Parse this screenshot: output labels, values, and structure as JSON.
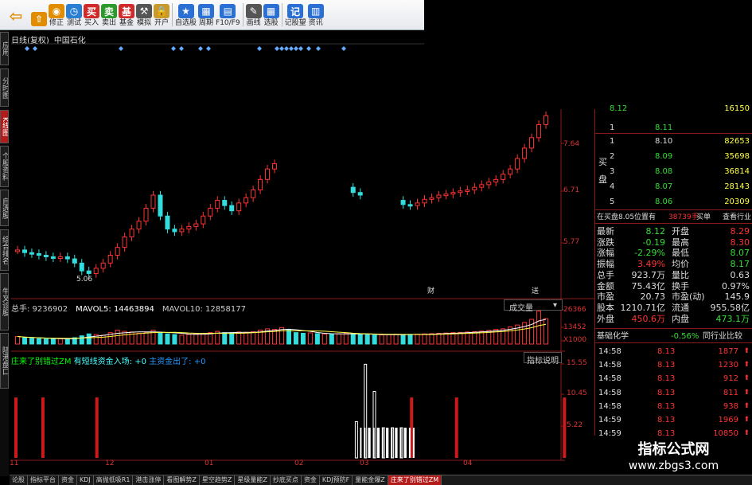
{
  "toolbar": [
    {
      "name": "back",
      "label": "",
      "icon": "back-arrow-icon",
      "color": "#e28c00",
      "big": true
    },
    {
      "name": "up",
      "label": "",
      "icon": "arrow-up-icon",
      "color": "#e28c00"
    },
    {
      "name": "modify",
      "label": "修正",
      "icon": "lifebuoy-icon",
      "color": "#e28c00"
    },
    {
      "name": "test",
      "label": "测试",
      "icon": "clock-icon",
      "color": "#2a7fd4"
    },
    {
      "name": "buy",
      "label": "买入",
      "icon": "buy-icon",
      "color": "#d02a2a",
      "text": "买"
    },
    {
      "name": "sell",
      "label": "卖出",
      "icon": "sell-icon",
      "color": "#2a9a2a",
      "text": "卖"
    },
    {
      "name": "fund",
      "label": "基金",
      "icon": "fund-icon",
      "color": "#d02a2a",
      "text": "基"
    },
    {
      "name": "simulate",
      "label": "模拟",
      "icon": "hammer-icon",
      "color": "#555"
    },
    {
      "name": "open",
      "label": "开户",
      "icon": "lock-icon",
      "color": "#c99a2a"
    },
    {
      "name": "watchlist",
      "label": "自选股",
      "icon": "star-icon",
      "color": "#2a6fd4"
    },
    {
      "name": "cycle",
      "label": "周期",
      "icon": "calendar-icon",
      "color": "#2a6fd4"
    },
    {
      "name": "f10",
      "label": "F10/F9",
      "icon": "document-icon",
      "color": "#2a6fd4"
    },
    {
      "name": "draw",
      "label": "画线",
      "icon": "pencil-icon",
      "color": "#555"
    },
    {
      "name": "select",
      "label": "选股",
      "icon": "grid-icon",
      "color": "#2a6fd4"
    },
    {
      "name": "note",
      "label": "记股望",
      "icon": "notebook-icon",
      "color": "#2a6fd4",
      "text": "记"
    },
    {
      "name": "news",
      "label": "资讯",
      "icon": "news-icon",
      "color": "#2a6fd4"
    }
  ],
  "side_tabs": [
    {
      "label": "应用",
      "active": false
    },
    {
      "label": "分时图",
      "active": false
    },
    {
      "label": "K线图",
      "active": true
    },
    {
      "label": "个股资料",
      "active": false
    },
    {
      "label": "自选股",
      "active": false
    },
    {
      "label": "综合排名",
      "active": false
    },
    {
      "label": "牛叉诊股",
      "active": false
    },
    {
      "label": "陆港盘口",
      "active": false
    }
  ],
  "kline": {
    "period": "日线(复权)",
    "stock": "中国石化",
    "price_labels": [
      "7.64",
      "6.71",
      "5.77"
    ],
    "low_label": "5.06",
    "marks": [
      "财",
      "送"
    ]
  },
  "volume_panel": {
    "total": "总手: 9236902",
    "ma5": "MAVOL5: 14463894",
    "ma10": "MAVOL10: 12858177",
    "selector": "成交量",
    "axis": [
      "26366",
      "13452",
      "X1000"
    ]
  },
  "indicator_panel": {
    "name": "庄来了别错过ZM",
    "text1": "有短线资金入场: +0",
    "text2": "主资金出了: +0",
    "explain": "指标说明",
    "axis": [
      "15.55",
      "10.45",
      "5.22"
    ]
  },
  "dates": [
    "11",
    "12",
    "01",
    "02",
    "03",
    "04"
  ],
  "bottom_tabs": [
    "论股",
    "指标平台",
    "资金",
    "KDJ",
    "高抛低吸R1",
    "港击涨停",
    "看图解势Z",
    "星空趋势Z",
    "星级量能Z",
    "抄底买点",
    "资金",
    "KDJ预防F",
    "量能金爆Z",
    "庄来了别错过ZM"
  ],
  "orderbook": {
    "top_partial": {
      "sell1_price": "8.12",
      "sell1_vol": "16150"
    },
    "sell1": {
      "idx": "1",
      "price": "8.11",
      "vol": ""
    },
    "buy_label": [
      "买",
      "盘"
    ],
    "buys": [
      {
        "idx": "1",
        "price": "8.10",
        "vol": "82653"
      },
      {
        "idx": "2",
        "price": "8.09",
        "vol": "35698"
      },
      {
        "idx": "3",
        "price": "8.08",
        "vol": "36814"
      },
      {
        "idx": "4",
        "price": "8.07",
        "vol": "28143"
      },
      {
        "idx": "5",
        "price": "8.06",
        "vol": "20309"
      }
    ],
    "bidline": {
      "text": "在买盘8.05位置有",
      "vol": "38739手",
      "buy_link": "买单",
      "industry_link": "查看行业"
    },
    "stats": [
      {
        "k1": "最新",
        "v1": "8.12",
        "c1": "green",
        "k2": "开盘",
        "v2": "8.29",
        "c2": "red"
      },
      {
        "k1": "涨跌",
        "v1": "-0.19",
        "c1": "green",
        "k2": "最高",
        "v2": "8.30",
        "c2": "red"
      },
      {
        "k1": "涨幅",
        "v1": "-2.29%",
        "c1": "green",
        "k2": "最低",
        "v2": "8.07",
        "c2": "green"
      },
      {
        "k1": "振幅",
        "v1": "3.49%",
        "c1": "red",
        "k2": "均价",
        "v2": "8.17",
        "c2": "green"
      },
      {
        "k1": "总手",
        "v1": "923.7万",
        "c1": "wht",
        "k2": "量比",
        "v2": "0.63",
        "c2": "wht"
      },
      {
        "k1": "金额",
        "v1": "75.43亿",
        "c1": "wht",
        "k2": "换手",
        "v2": "0.97%",
        "c2": "wht"
      },
      {
        "k1": "市盈",
        "v1": "20.73",
        "c1": "wht",
        "k2": "市盈(动)",
        "v2": "145.9",
        "c2": "wht"
      },
      {
        "k1": "股本",
        "v1": "1210.71亿",
        "c1": "wht",
        "k2": "流通",
        "v2": "955.58亿",
        "c2": "wht"
      },
      {
        "k1": "外盘",
        "v1": "450.6万",
        "c1": "red",
        "k2": "内盘",
        "v2": "473.1万",
        "c2": "green"
      }
    ],
    "sector": {
      "name": "基础化学",
      "pct": "-0.56%",
      "link": "同行业比较"
    },
    "ticks": [
      {
        "t": "14:58",
        "p": "8.13",
        "v": "1877"
      },
      {
        "t": "14:58",
        "p": "8.13",
        "v": "1230"
      },
      {
        "t": "14:58",
        "p": "8.13",
        "v": "912"
      },
      {
        "t": "14:58",
        "p": "8.13",
        "v": "811"
      },
      {
        "t": "14:58",
        "p": "8.13",
        "v": "938"
      },
      {
        "t": "14:59",
        "p": "8.13",
        "v": "1969"
      },
      {
        "t": "14:59",
        "p": "8.13",
        "v": "10850"
      }
    ]
  },
  "watermark": {
    "title": "指标公式网",
    "url": "www.zbgs3.com"
  },
  "colors": {
    "up": "#ff3333",
    "down": "#33dddd",
    "ma5": "#ffffff",
    "ma10": "#ffff44",
    "indicator_red": "#cc1a1a",
    "indicator_white": "#ffffff",
    "grid": "#8a1a1a"
  },
  "chart_data": [
    {
      "type": "candlestick",
      "title": "日线(复权) 中国石化",
      "note": "approximate closes read from chart",
      "close": [
        5.55,
        5.5,
        5.48,
        5.45,
        5.42,
        5.4,
        5.42,
        5.38,
        5.3,
        5.15,
        5.1,
        5.2,
        5.3,
        5.45,
        5.6,
        5.8,
        5.95,
        6.1,
        6.35,
        6.6,
        6.2,
        5.95,
        5.9,
        5.95,
        6.0,
        6.05,
        6.2,
        6.35,
        6.5,
        6.4,
        6.3,
        6.45,
        6.55,
        6.7,
        6.9,
        7.1,
        7.2,
        7.3,
        7.0,
        6.8,
        6.75,
        6.9,
        6.6,
        6.7,
        6.55,
        6.6,
        6.75,
        6.65,
        6.6,
        6.4,
        6.35,
        6.4,
        6.45,
        6.5,
        6.42,
        6.4,
        6.45,
        6.52,
        6.55,
        6.6,
        6.62,
        6.65,
        6.68,
        6.7,
        6.75,
        6.8,
        6.85,
        6.9,
        7.0,
        7.1,
        7.3,
        7.5,
        7.7,
        7.95,
        8.12
      ],
      "ylim": [
        5.0,
        8.2
      ]
    },
    {
      "type": "bar",
      "title": "成交量",
      "note": "approximate, units of x1000",
      "values": [
        6000,
        5000,
        4500,
        4200,
        4000,
        4300,
        4100,
        3900,
        5000,
        6500,
        8000,
        7500,
        7000,
        9000,
        11000,
        10000,
        9500,
        8500,
        9000,
        11000,
        9000,
        8000,
        7500,
        7000,
        7600,
        8000,
        8500,
        9000,
        10000,
        9000,
        8500,
        9500,
        9200,
        9800,
        11000,
        12000,
        11500,
        13000,
        11000,
        9000,
        8500,
        8800,
        8200,
        7900,
        7600,
        8000,
        8400,
        8100,
        7800,
        7200,
        7000,
        7300,
        7500,
        7700,
        7400,
        7600,
        7800,
        8000,
        8200,
        8500,
        8700,
        9000,
        9200,
        9500,
        9800,
        10200,
        10800,
        11500,
        12000,
        13500,
        15000,
        17000,
        19500,
        26000,
        20000
      ],
      "ylim": [
        0,
        26366
      ]
    },
    {
      "type": "bar",
      "title": "庄来了别错过ZM",
      "red_positions": [
        0,
        3,
        9,
        44,
        49,
        61
      ],
      "white_positions": [
        38,
        39,
        40,
        41,
        42,
        43
      ],
      "white_values": [
        6,
        15.5,
        11,
        5,
        5,
        5
      ],
      "ylim": [
        0,
        15.55
      ]
    }
  ]
}
